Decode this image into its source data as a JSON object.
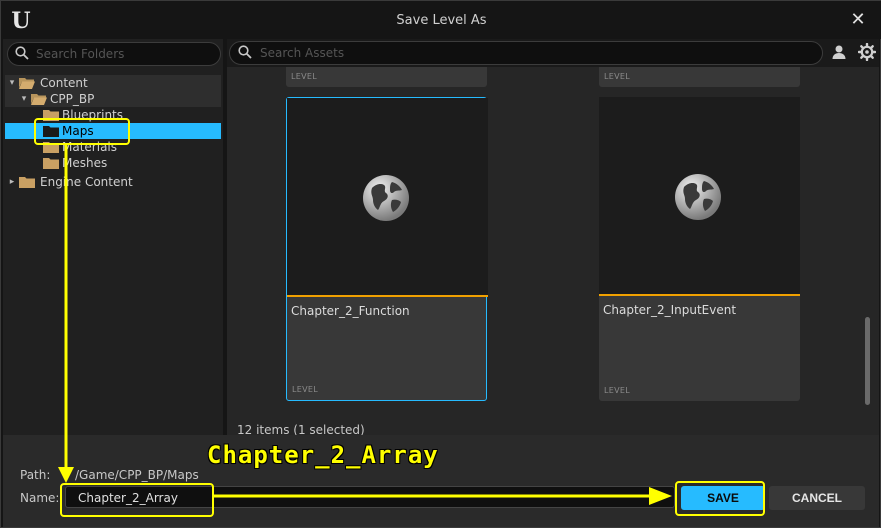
{
  "window": {
    "title": "Save Level As",
    "logo": "U",
    "close_glyph": "✕"
  },
  "folder_search": {
    "placeholder": "Search Folders"
  },
  "asset_search": {
    "placeholder": "Search Assets"
  },
  "tree": [
    {
      "label": "Content",
      "arrow": "▾",
      "open": true
    },
    {
      "label": "CPP_BP",
      "arrow": "▾",
      "open": true
    },
    {
      "label": "Blueprints"
    },
    {
      "label": "Maps",
      "selected": true
    },
    {
      "label": "Materials"
    },
    {
      "label": "Meshes"
    },
    {
      "label": "Engine Content",
      "arrow": "▸"
    }
  ],
  "assets": {
    "top_row_type": "LEVEL",
    "tiles": [
      {
        "name": "Chapter_2_Function",
        "type": "LEVEL",
        "selected": true
      },
      {
        "name": "Chapter_2_InputEvent",
        "type": "LEVEL",
        "selected": false
      }
    ],
    "status": "12 items (1 selected)"
  },
  "footer": {
    "path_label": "Path:",
    "path_value": "/Game/CPP_BP/Maps",
    "name_label": "Name:",
    "name_value": "Chapter_2_Array",
    "save_label": "SAVE",
    "cancel_label": "CANCEL"
  },
  "annotation": {
    "text": "Chapter_2_Array",
    "color": "#ffff00"
  },
  "colors": {
    "accent": "#26bbff",
    "level_stripe": "#f0a000",
    "highlight": "#ffff00"
  },
  "icons": [
    "unreal-logo-icon",
    "close-icon",
    "search-icon",
    "folder-icon",
    "globe-icon",
    "user-icon",
    "settings-icon"
  ]
}
